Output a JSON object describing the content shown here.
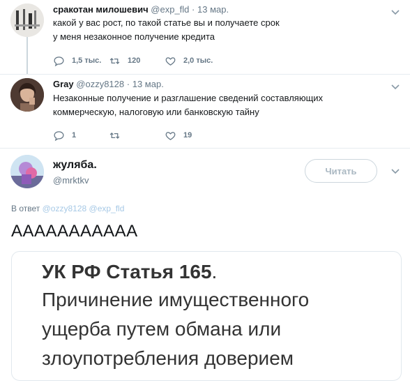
{
  "tweets": [
    {
      "name": "сракотан милошевич",
      "handle": "@exp_fld",
      "separator": "·",
      "date": "13 мар.",
      "text_lines": [
        "какой у вас рост, по такой статье вы и получаете срок",
        "у меня незаконное получение кредита"
      ],
      "replies": "1,5 тыс.",
      "retweets": "120",
      "likes": "2,0 тыс."
    },
    {
      "name": "Gray",
      "handle": "@ozzy8128",
      "separator": "·",
      "date": "13 мар.",
      "text_lines": [
        "Незаконные получение и разглашение сведений составляющих",
        "коммерческую, налоговую или банковскую тайну"
      ],
      "replies": "1",
      "retweets": "",
      "likes": "19"
    }
  ],
  "focused": {
    "name": "жуляба.",
    "handle": "@mrktkv",
    "follow_label": "Читать",
    "replying_prefix": "В ответ",
    "replying_to": [
      "@ozzy8128",
      "@exp_fld"
    ],
    "text": "ААААААААААА",
    "media": {
      "title_bold": "УК РФ Статья 165",
      "title_suffix": ".",
      "body_lines": [
        "Причинение имущественного",
        "ущерба путем обмана или",
        "злоупотребления доверием"
      ]
    }
  },
  "colors": {
    "text": "#14171a",
    "muted": "#657786",
    "border": "#e1e8ed",
    "mention": "#a7c9e6"
  }
}
